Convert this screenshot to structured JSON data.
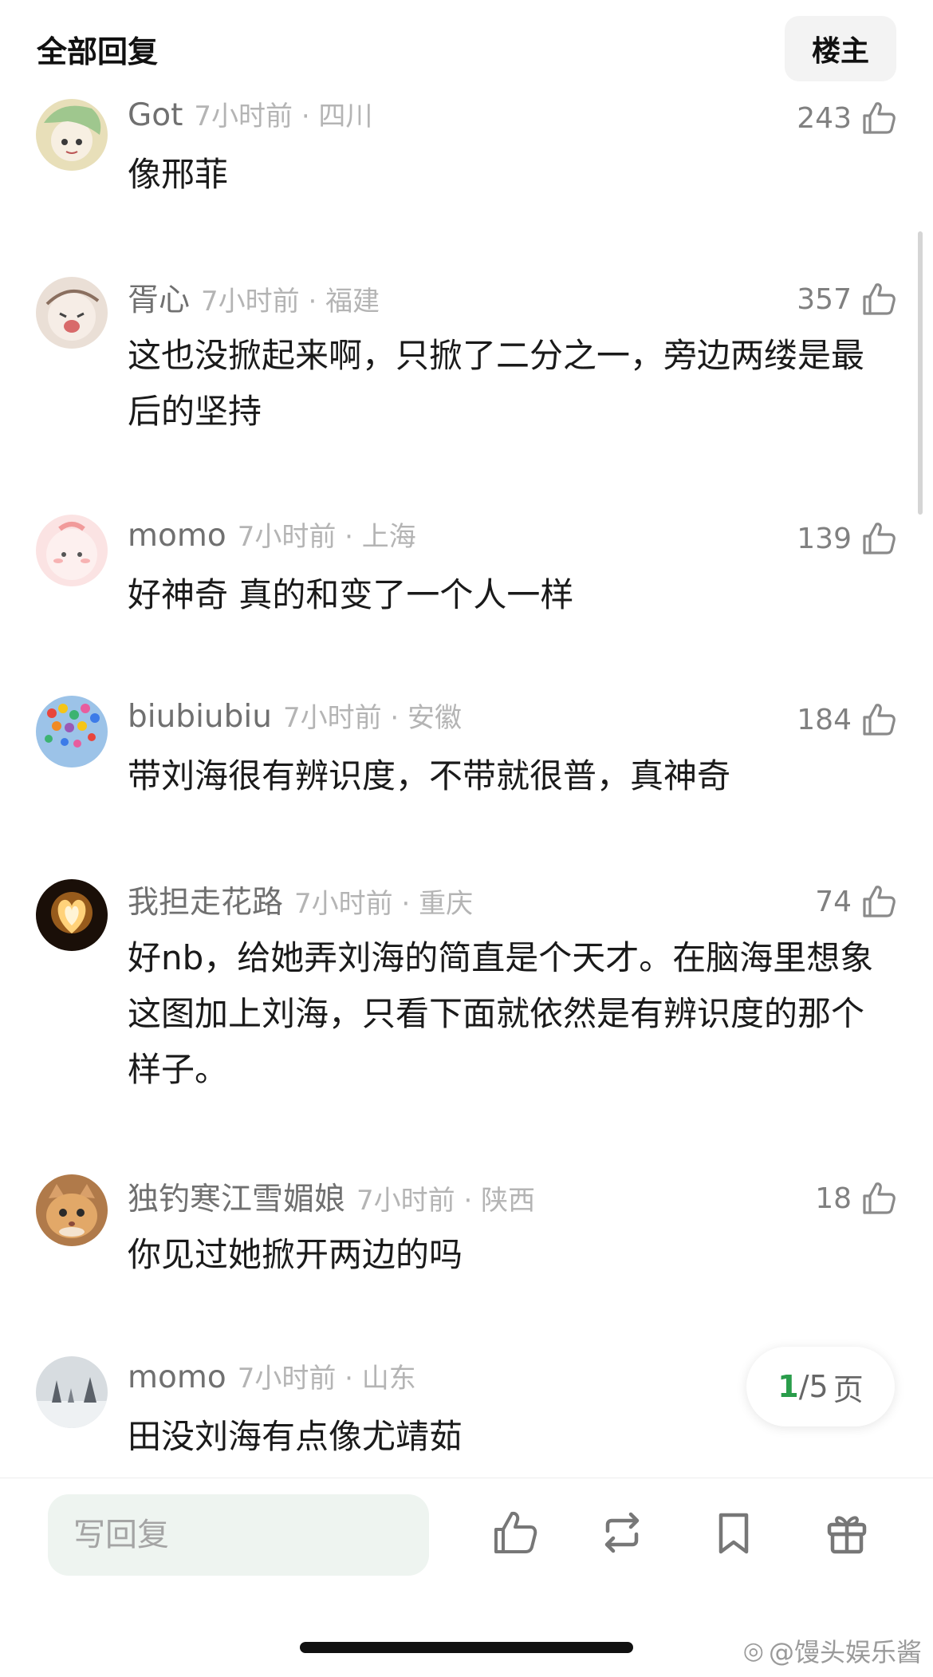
{
  "header": {
    "title": "全部回复",
    "op_button": "楼主"
  },
  "comments": [
    {
      "user": "Got",
      "info": "7小时前 · 四川",
      "likes": "243",
      "text": "像邢菲"
    },
    {
      "user": "胥心",
      "info": "7小时前 · 福建",
      "likes": "357",
      "text": "这也没掀起来啊，只掀了二分之一，旁边两缕是最后的坚持"
    },
    {
      "user": "momo",
      "info": "7小时前 · 上海",
      "likes": "139",
      "text": "好神奇 真的和变了一个人一样"
    },
    {
      "user": "biubiubiu",
      "info": "7小时前 · 安徽",
      "likes": "184",
      "text": "带刘海很有辨识度，不带就很普，真神奇"
    },
    {
      "user": "我担走花路",
      "info": "7小时前 · 重庆",
      "likes": "74",
      "text": "好nb，给她弄刘海的简直是个天才。在脑海里想象这图加上刘海，只看下面就依然是有辨识度的那个样子。"
    },
    {
      "user": "独钓寒江雪媚娘",
      "info": "7小时前 · 陕西",
      "likes": "18",
      "text": "你见过她掀开两边的吗"
    },
    {
      "user": "momo",
      "info": "7小时前 · 山东",
      "likes": "",
      "text": "田没刘海有点像尤靖茹"
    }
  ],
  "pager": {
    "current": "1",
    "total": "/5",
    "unit": "页"
  },
  "bottom_bar": {
    "reply_placeholder": "写回复",
    "icons": [
      "like-icon",
      "repost-icon",
      "bookmark-icon",
      "gift-icon"
    ]
  },
  "watermark": "@馒头娱乐酱",
  "colors": {
    "accent_green": "#2a9d4b",
    "input_bg": "#eef4f0"
  }
}
